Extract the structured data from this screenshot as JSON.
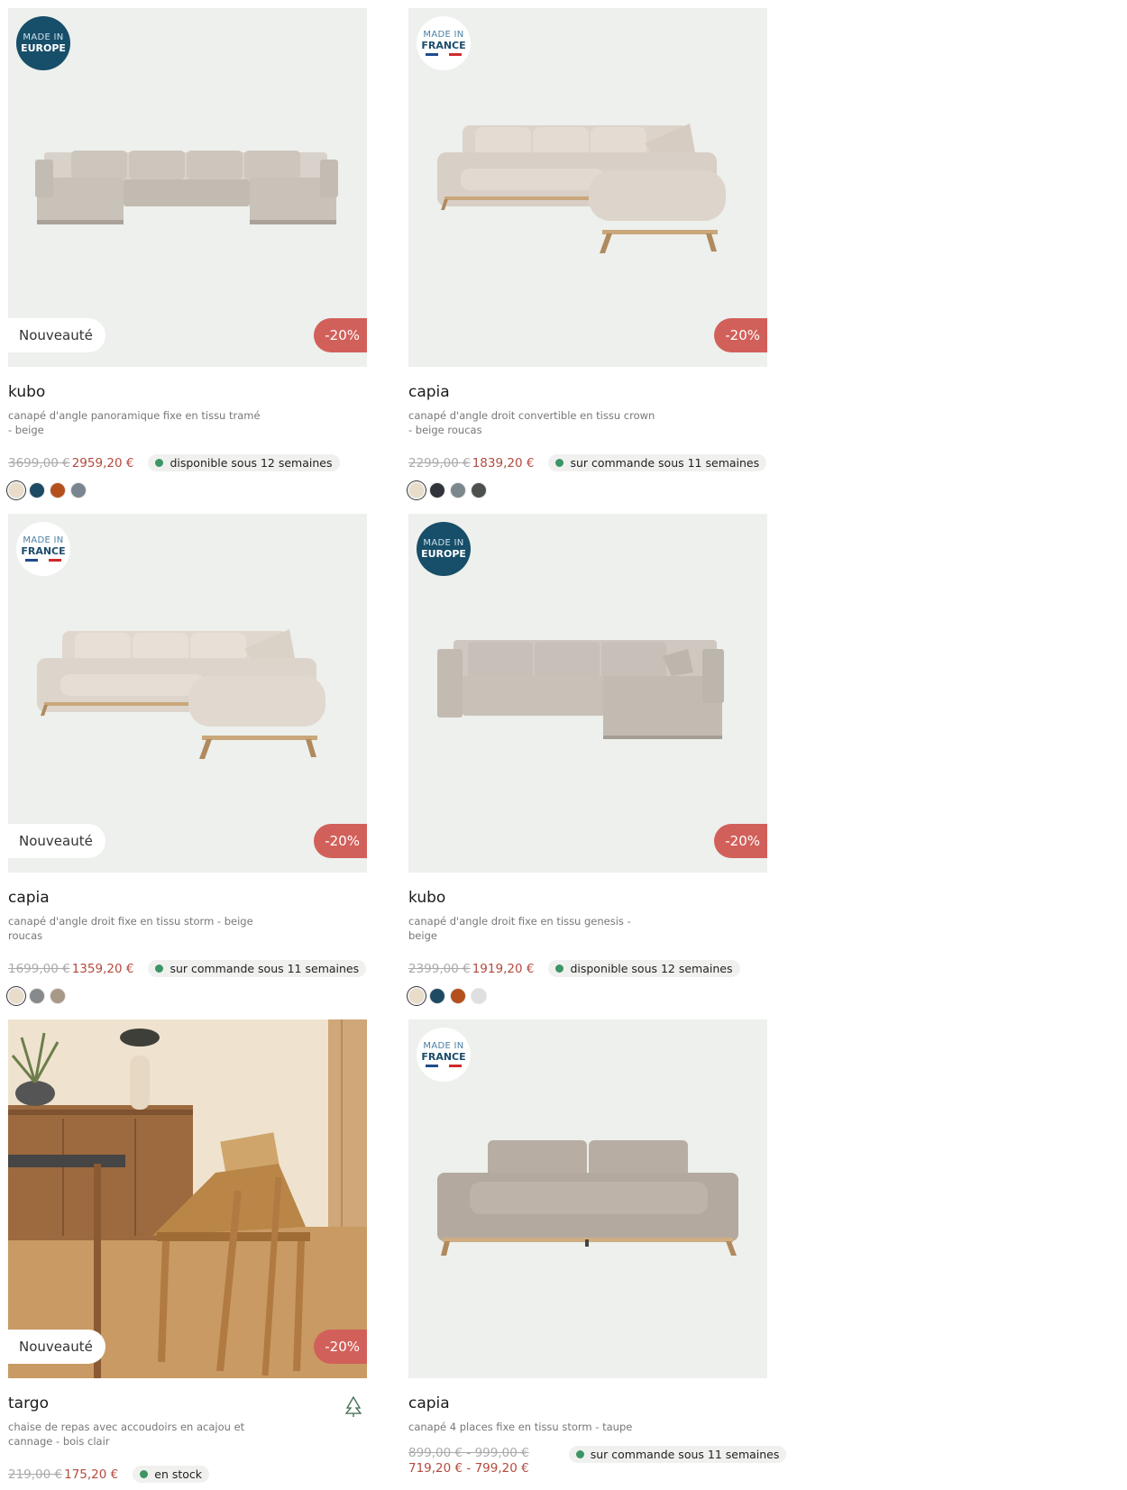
{
  "products": [
    {
      "name": "kubo",
      "description": "canapé d'angle panoramique fixe en tissu tramé - beige",
      "badge": {
        "type": "europe",
        "line1": "MADE IN",
        "line2": "EUROPE"
      },
      "new_tag": "Nouveauté",
      "discount": "-20%",
      "old_price": "3699,00 €",
      "new_price": "2959,20 €",
      "availability": "disponible sous 12 semaines",
      "swatches": [
        "#e9ddca",
        "#1f4a63",
        "#b4501c",
        "#7a8590"
      ],
      "image_icon": "sofa-panoramic-icon"
    },
    {
      "name": "capia",
      "description": "canapé d'angle droit convertible en tissu crown - beige roucas",
      "badge": {
        "type": "france",
        "line1": "MADE IN",
        "line2": "FRANCE"
      },
      "new_tag": "",
      "discount": "-20%",
      "old_price": "2299,00 €",
      "new_price": "1839,20 €",
      "availability": "sur commande sous 11 semaines",
      "swatches": [
        "#e9ddca",
        "#30333a",
        "#7c868d",
        "#4d514d"
      ],
      "image_icon": "sofa-corner-icon"
    },
    {
      "name": "capia",
      "description": "canapé d'angle droit fixe en tissu storm - beige roucas",
      "badge": {
        "type": "france",
        "line1": "MADE IN",
        "line2": "FRANCE"
      },
      "new_tag": "Nouveauté",
      "discount": "-20%",
      "old_price": "1699,00 €",
      "new_price": "1359,20 €",
      "availability": "sur commande sous 11 semaines",
      "swatches": [
        "#e9ddca",
        "#868a8c",
        "#a89888"
      ],
      "image_icon": "sofa-corner-icon"
    },
    {
      "name": "kubo",
      "description": "canapé d'angle droit fixe en tissu genesis - beige",
      "badge": {
        "type": "europe",
        "line1": "MADE IN",
        "line2": "EUROPE"
      },
      "new_tag": "",
      "discount": "-20%",
      "old_price": "2399,00 €",
      "new_price": "1919,20 €",
      "availability": "disponible sous 12 semaines",
      "swatches": [
        "#e9ddca",
        "#1f4a63",
        "#b4501c",
        "#dddfe0"
      ],
      "image_icon": "sofa-corner-boxy-icon"
    },
    {
      "name": "targo",
      "description": "chaise de repas avec accoudoirs en acajou et cannage - bois clair",
      "badge": null,
      "new_tag": "Nouveauté",
      "discount": "-20%",
      "old_price": "219,00 €",
      "new_price": "175,20 €",
      "availability": "en stock",
      "swatches": [],
      "image_icon": "dining-chair-photo",
      "certification_icon": "fsc-tree-icon"
    },
    {
      "name": "capia",
      "description": "canapé 4 places fixe en tissu storm - taupe",
      "badge": {
        "type": "france",
        "line1": "MADE IN",
        "line2": "FRANCE"
      },
      "new_tag": "",
      "discount": "",
      "old_price": "899,00 € - 999,00 €",
      "new_price": "719,20 € - 799,20 €",
      "availability": "sur commande sous 11 semaines",
      "swatches": [],
      "image_icon": "sofa-4-seat-icon"
    }
  ]
}
